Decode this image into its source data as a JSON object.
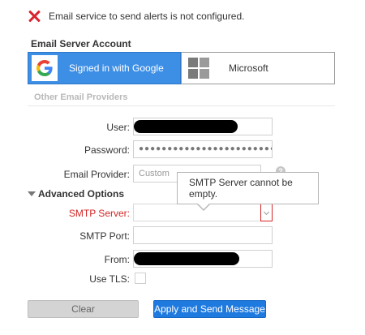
{
  "alert": {
    "icon": "error-x-icon",
    "message": "Email service to send alerts is not configured."
  },
  "account_section": {
    "title": "Email Server Account",
    "google_label": "Signed in with Google",
    "microsoft_label": "Microsoft",
    "other_providers": "Other Email Providers"
  },
  "form": {
    "user_label": "User:",
    "password_label": "Password:",
    "password_mask": "●●●●●●●●●●●●●●●●●●●●●●●●●●●●●",
    "provider_label": "Email Provider:",
    "provider_value": "Custom",
    "help": "?",
    "advanced_label": "Advanced Options",
    "smtp_server_label": "SMTP Server:",
    "smtp_port_label": "SMTP Port:",
    "from_label": "From:",
    "tls_label": "Use TLS:"
  },
  "tooltip": {
    "text": "SMTP Server cannot be empty."
  },
  "buttons": {
    "clear": "Clear",
    "apply": "Apply and Send Message"
  },
  "colors": {
    "error": "#d9232e",
    "google_active": "#3d8fe6",
    "primary_button": "#1f7ae0"
  }
}
